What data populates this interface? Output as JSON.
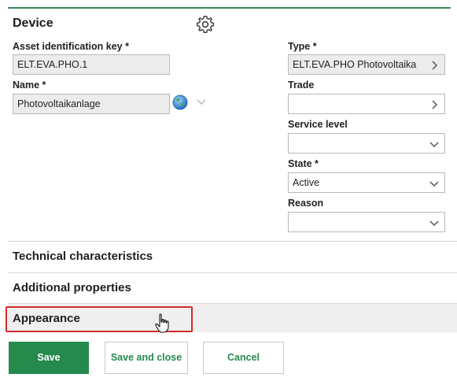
{
  "device_section": {
    "title": "Device",
    "settings_icon": "gear-icon",
    "asset_key": {
      "label": "Asset identification key *",
      "value": "ELT.EVA.PHO.1"
    },
    "name": {
      "label": "Name *",
      "value": "Photovoltaikanlage",
      "globe_icon": "globe-icon"
    },
    "type": {
      "label": "Type *",
      "value": "ELT.EVA.PHO Photovoltaika"
    },
    "trade": {
      "label": "Trade",
      "value": ""
    },
    "service_level": {
      "label": "Service level",
      "value": ""
    },
    "state": {
      "label": "State *",
      "value": "Active"
    },
    "reason": {
      "label": "Reason",
      "value": ""
    }
  },
  "sections": {
    "technical": "Technical characteristics",
    "additional": "Additional properties",
    "appearance": "Appearance"
  },
  "buttons": {
    "save": "Save",
    "save_close": "Save and close",
    "cancel": "Cancel"
  },
  "colors": {
    "accent": "#268a4d",
    "highlight": "#d42a2a"
  }
}
